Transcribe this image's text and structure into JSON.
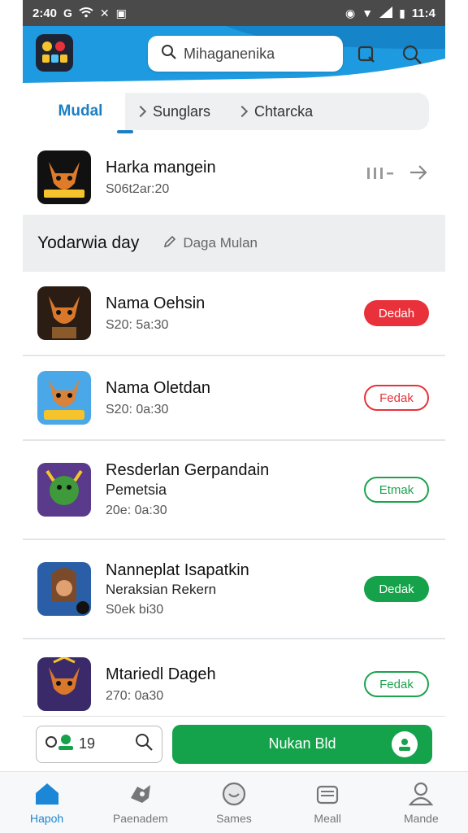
{
  "status_bar": {
    "time_left": "2:40",
    "time_right": "11:4",
    "icons": [
      "google-icon",
      "wifi-icon",
      "notification-icon",
      "photo-icon",
      "alarm-icon",
      "wifi-icon",
      "signal-icon",
      "battery-icon"
    ]
  },
  "header": {
    "search_placeholder": "Mihaganenika",
    "logo_icon": "game-logo-icon"
  },
  "breadcrumb": {
    "items": [
      "Mudal",
      "Sunglars",
      "Chtarcka"
    ]
  },
  "featured": {
    "title": "Harka mangein",
    "subtitle": "S06t2ar:20"
  },
  "section": {
    "title": "Yodarwia day",
    "link": "Daga Mulan"
  },
  "items": [
    {
      "title": "Nama Oehsin",
      "lines": [
        "S20: 5a:30"
      ],
      "button": "Dedah",
      "button_style": "red"
    },
    {
      "title": "Nama Oletdan",
      "lines": [
        "S20: 0a:30"
      ],
      "button": "Fedak",
      "button_style": "red-out"
    },
    {
      "title": "Resderlan Gerpandain",
      "lines": [
        "Pemetsia",
        "20e: 0a:30"
      ],
      "button": "Etmak",
      "button_style": "green-out"
    },
    {
      "title": "Nanneplat Isapatkin",
      "lines": [
        "Neraksian Rekern",
        "S0ek bi30"
      ],
      "button": "Dedak",
      "button_style": "green"
    },
    {
      "title": "Mtariedl Dageh",
      "lines": [
        "270: 0a30"
      ],
      "button": "Fedak",
      "button_style": "green-out"
    }
  ],
  "action_bar": {
    "mini_value": "19",
    "cta_label": "Nukan Bld"
  },
  "nav": [
    {
      "label": "Hapoh",
      "icon": "home-icon",
      "active": true
    },
    {
      "label": "Paenadem",
      "icon": "controller-icon",
      "active": false
    },
    {
      "label": "Sames",
      "icon": "smile-icon",
      "active": false
    },
    {
      "label": "Meall",
      "icon": "inbox-icon",
      "active": false
    },
    {
      "label": "Mande",
      "icon": "person-icon",
      "active": false
    }
  ],
  "colors": {
    "accent_blue": "#1b87d6",
    "red": "#e8313a",
    "green": "#15a24a"
  }
}
